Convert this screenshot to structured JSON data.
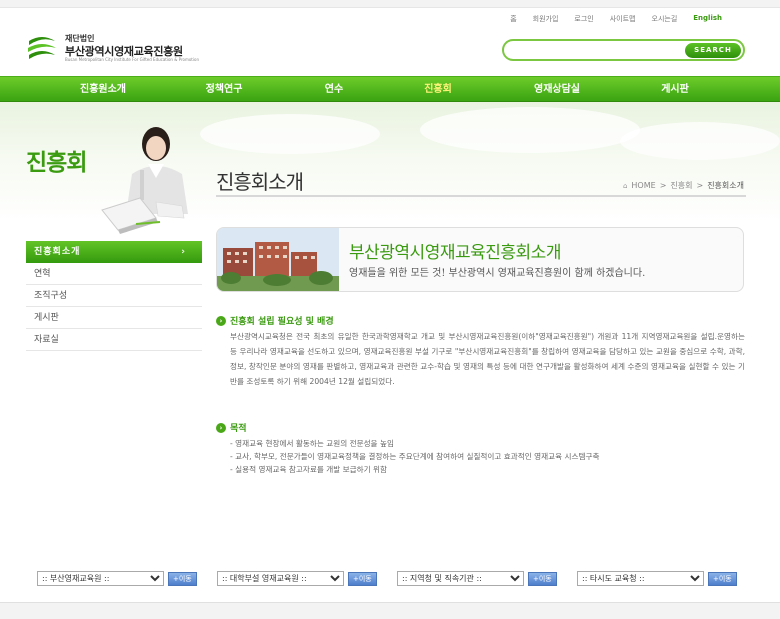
{
  "util_links": [
    {
      "label": "홈",
      "key": "home"
    },
    {
      "label": "회원가입",
      "key": "join"
    },
    {
      "label": "로그인",
      "key": "login"
    },
    {
      "label": "사이트맵",
      "key": "sitemap"
    },
    {
      "label": "오시는길",
      "key": "directions"
    },
    {
      "label": "English",
      "key": "english"
    }
  ],
  "logo": {
    "line1": "재단법인",
    "line2": "부산광역시영재교육진흥원",
    "line3": "Busan Metropolitan City Institute For Gifted Education & Promotion"
  },
  "search": {
    "placeholder": "",
    "button_label": "SEARCH"
  },
  "gnb": [
    {
      "label": "진흥원소개",
      "active": false
    },
    {
      "label": "정책연구",
      "active": false
    },
    {
      "label": "연수",
      "active": false
    },
    {
      "label": "진흥회",
      "active": true
    },
    {
      "label": "영재상담실",
      "active": false
    },
    {
      "label": "게시판",
      "active": false
    }
  ],
  "side": {
    "title": "진흥회",
    "active_item": "진흥회소개",
    "active_arrow": "›",
    "items": [
      "연혁",
      "조직구성",
      "게시판",
      "자료실"
    ]
  },
  "page": {
    "title": "진흥회소개",
    "breadcrumb": {
      "home_icon": "⌂",
      "home": "HOME",
      "sep": ">",
      "level1": "진흥회",
      "level2": "진흥회소개"
    }
  },
  "banner": {
    "title": "부산광역시영재교육진흥회소개",
    "subtitle": "영재들을 위한 모든 것! 부산광역시 영재교육진흥원이 함께 하겠습니다."
  },
  "sections": {
    "necessity": {
      "heading": "진흥회 설립 필요성 및 배경",
      "body": "부산광역시교육청은 전국 최초의 유일한 한국과학영재학교 개교 및 부산시영재교육진흥원(이하\"영재교육진흥원\") 개원과 11개 지역영재교육원을 설립.운영하는 등 우리나라 영재교육을 선도하고 있으며, 영재교육진흥원 부설 기구로 \"부산시영재교육진흥회\"를 창립하여 영재교육을 담당하고 있는 교원을 중심으로 수학, 과학, 정보, 창작인문 분야의 영재를 판별하고, 영재교육과 관련한 교수-학습 및 영재의 특성 등에 대한 연구개발을 활성화하여 세계 수준의 영재교육을 실현할 수 있는 기반를 조성토록 하기 위해 2004년 12월 설립되었다."
    },
    "purpose": {
      "heading": "목적",
      "items": [
        "- 영재교육 현장에서 활동하는 교원의 전문성을 높임",
        "- 교사, 학부모, 전문가들이 영재교육정책을 결정하는 주요단계에 참여하여 실질적이고 효과적인 영재교육 시스템구축",
        "- 실용적 영재교육 참고자료를 개발 보급하기 위함"
      ]
    },
    "bullet_glyph": "›"
  },
  "footer_selects": [
    {
      "selected": ":: 부산영재교육원 ::",
      "button": "+이동"
    },
    {
      "selected": ":: 대학부설 영재교육원 ::",
      "button": "+이동"
    },
    {
      "selected": ":: 지역청 및 직속기관 ::",
      "button": "+이동"
    },
    {
      "selected": ":: 타시도 교육청 ::",
      "button": "+이동"
    }
  ],
  "colors": {
    "brand_green": "#3a9a10",
    "nav_active": "#fff37a",
    "button_blue": "#4f7fcc"
  },
  "icons": [
    "home-icon",
    "search-icon",
    "arrow-right-icon",
    "logo-mark-icon"
  ]
}
